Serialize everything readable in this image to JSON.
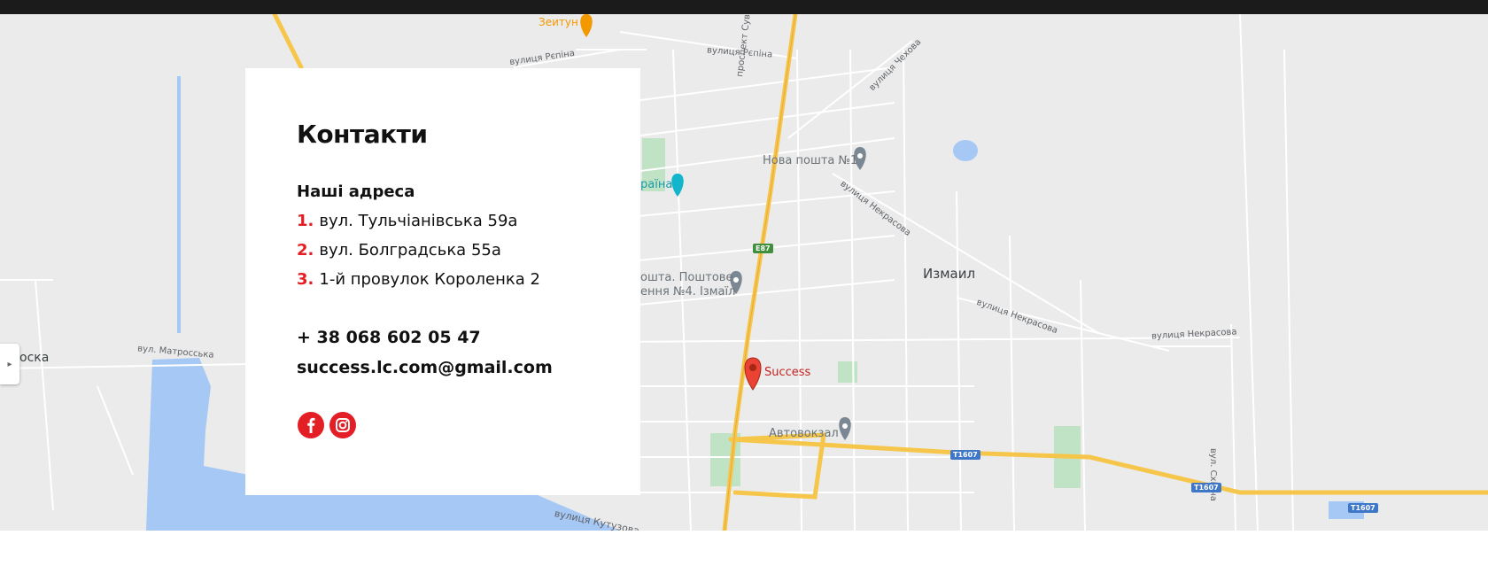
{
  "colors": {
    "accent": "#e31e24",
    "map_background": "#ebebeb",
    "road_major": "#f6c64b",
    "water": "#a6c8f5",
    "park": "#bfe3c4"
  },
  "map": {
    "labels": {
      "zeitun": "Зеитун",
      "repina_1": "вулиця Рєпіна",
      "repina_2": "вулиця Рєпіна",
      "chekhova": "вулиця Чехова",
      "suvorova": "проспект Суворова",
      "nekrasova_1": "вулиця Некрасова",
      "nekrasova_2": "вулиця Некрасова",
      "nekrasova_3": "вулиця Некрасова",
      "matrosska": "вул. Матросська",
      "kutuzova": "вулиця Кутузова",
      "skidna": "вул. Східна",
      "oska": "оска"
    },
    "pois": {
      "nova_poshta": "Нова пошта №1",
      "ukraina": "раїна",
      "ukrposhta_line1": "ошта. Поштове",
      "ukrposhta_line2": "ення №4. Ізмаїл",
      "avtovokzal": "Автовокзал",
      "success": "Success"
    },
    "city": "Измаил",
    "shields": {
      "e87": "E87",
      "t1607_a": "T1607",
      "t1607_b": "T1607",
      "t1607_c": "T1607"
    },
    "icons": {
      "toggle": "chevron-right-icon",
      "marker": "map-pin-icon",
      "poi": "poi-pin-icon"
    }
  },
  "contacts": {
    "title": "Контакти",
    "addresses_heading": "Наші адреса",
    "addresses": [
      {
        "num": "1.",
        "text": "вул. Тульчіанівська 59а"
      },
      {
        "num": "2.",
        "text": "вул. Болградська 55а"
      },
      {
        "num": "3.",
        "text": "1-й провулок Короленка 2"
      }
    ],
    "phone": "+ 38 068 602 05 47",
    "email": "success.lc.com@gmail.com",
    "social": [
      "facebook-icon",
      "instagram-icon"
    ]
  }
}
